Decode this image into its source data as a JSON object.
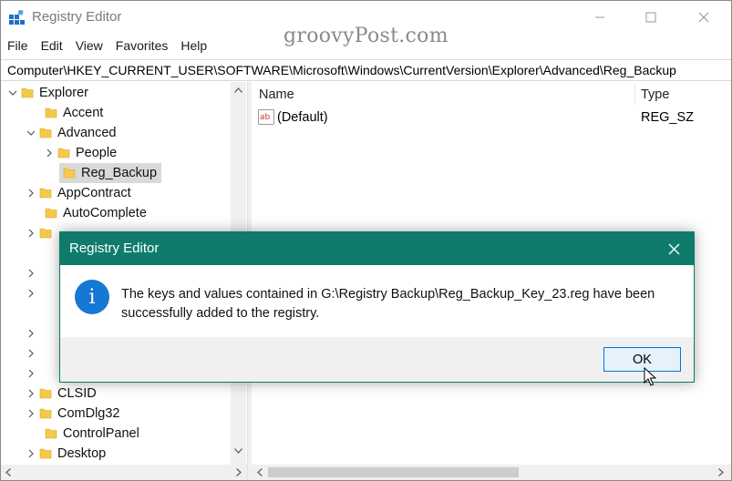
{
  "window": {
    "title": "Registry Editor",
    "colors": {
      "dialog_title": "#0f7c6b",
      "info_icon": "#1777d4",
      "selection": "#d9d9d9"
    }
  },
  "menu": [
    "File",
    "Edit",
    "View",
    "Favorites",
    "Help"
  ],
  "watermark": "groovyPost.com",
  "address": "Computer\\HKEY_CURRENT_USER\\SOFTWARE\\Microsoft\\Windows\\CurrentVersion\\Explorer\\Advanced\\Reg_Backup",
  "tree": {
    "items": [
      {
        "label": "Explorer",
        "expanded": true
      },
      {
        "label": "Accent"
      },
      {
        "label": "Advanced",
        "expanded": true
      },
      {
        "label": "People"
      },
      {
        "label": "Reg_Backup",
        "selected": true
      },
      {
        "label": "AppContract"
      },
      {
        "label": "AutoComplete"
      },
      {
        "label": "CLSID"
      },
      {
        "label": "ComDlg32"
      },
      {
        "label": "ControlPanel"
      },
      {
        "label": "Desktop"
      }
    ]
  },
  "list": {
    "columns": [
      "Name",
      "Type"
    ],
    "rows": [
      {
        "name": "(Default)",
        "type": "REG_SZ",
        "icon": "string-value-icon"
      }
    ]
  },
  "dialog": {
    "title": "Registry Editor",
    "icon": "info-icon",
    "line1": "The keys and values contained in G:\\Registry Backup\\Reg_Backup_Key_23.reg have been",
    "line2": "successfully added to the registry.",
    "ok_label": "OK"
  }
}
